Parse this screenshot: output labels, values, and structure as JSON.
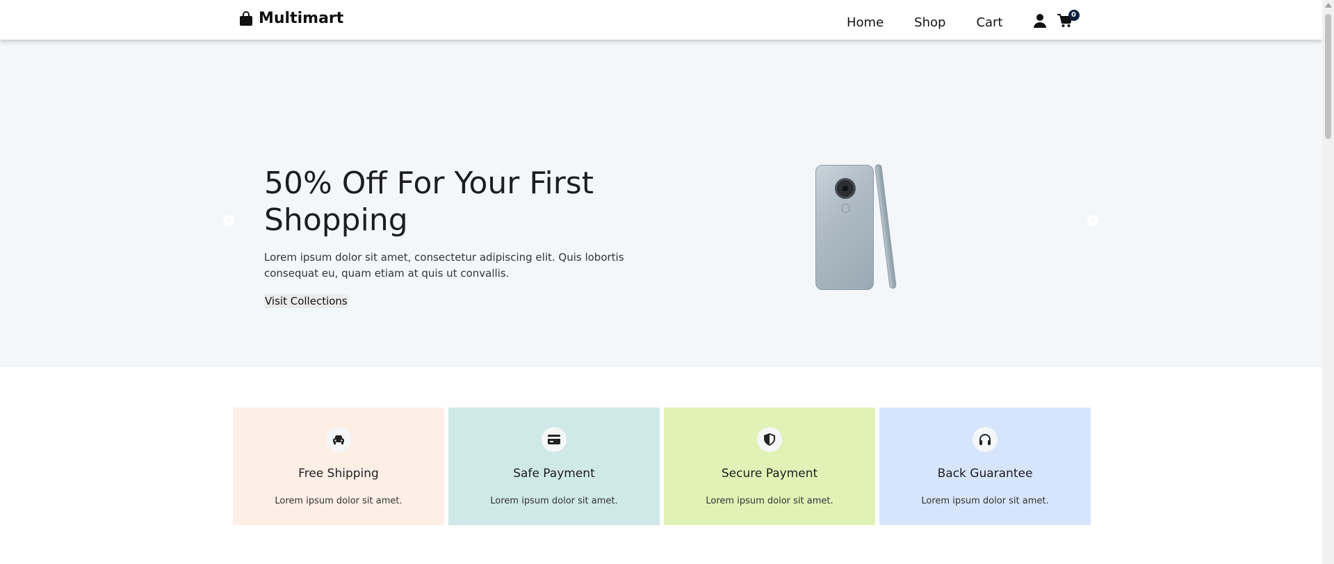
{
  "header": {
    "logo_text": "Multimart",
    "nav": [
      "Home",
      "Shop",
      "Cart"
    ],
    "cart_count": "0"
  },
  "hero": {
    "title": "50% Off For Your First Shopping",
    "text": "Lorem ipsum dolor sit amet, consectetur adipiscing elit. Quis lobortis consequat eu, quam etiam at quis ut convallis.",
    "button": "Visit Collections",
    "prev_icon": "chevron-left-icon",
    "next_icon": "chevron-right-icon"
  },
  "services": [
    {
      "title": "Free Shipping",
      "text": "Lorem ipsum dolor sit amet.",
      "icon": "car-icon",
      "bg": "#fdefe6"
    },
    {
      "title": "Safe Payment",
      "text": "Lorem ipsum dolor sit amet.",
      "icon": "card-icon",
      "bg": "#cfe9e8"
    },
    {
      "title": "Secure Payment",
      "text": "Lorem ipsum dolor sit amet.",
      "icon": "shield-icon",
      "bg": "#e1f2b6"
    },
    {
      "title": "Back Guarantee",
      "text": "Lorem ipsum dolor sit amet.",
      "icon": "headphones-icon",
      "bg": "#d6e5fb"
    }
  ],
  "colors": {
    "hero_bg": "#f4f7fa",
    "badge_bg": "#0b1f3f"
  }
}
